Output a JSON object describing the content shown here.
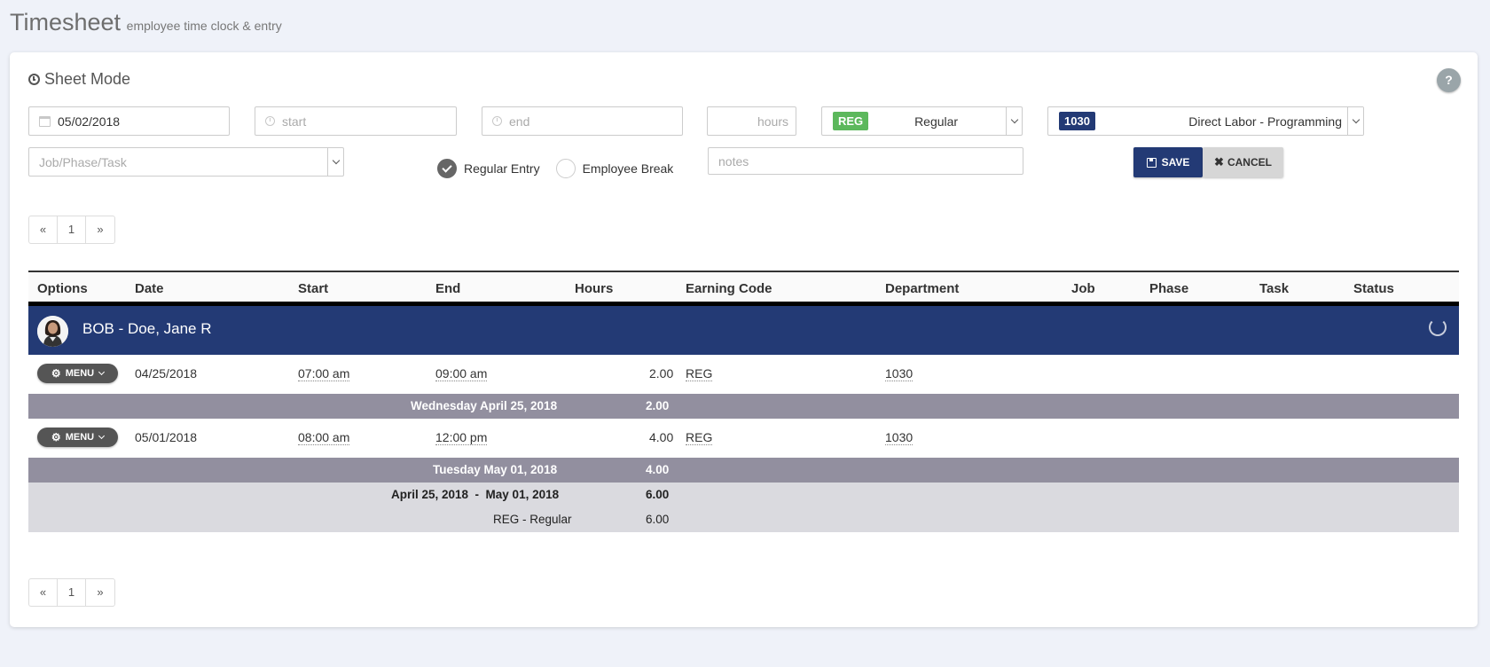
{
  "page": {
    "title": "Timesheet",
    "subtitle": "employee time clock & entry"
  },
  "panel": {
    "heading": "Sheet Mode",
    "help_label": "?"
  },
  "form": {
    "date_value": "05/02/2018",
    "start_placeholder": "start",
    "end_placeholder": "end",
    "hours_placeholder": "hours",
    "earning_code": {
      "badge": "REG",
      "label": "Regular"
    },
    "department": {
      "badge": "1030",
      "label": "Direct Labor - Programming"
    },
    "job_placeholder": "Job/Phase/Task",
    "entry_types": [
      {
        "label": "Regular Entry",
        "checked": true
      },
      {
        "label": "Employee Break",
        "checked": false
      }
    ],
    "notes_placeholder": "notes",
    "save_label": "SAVE",
    "cancel_label": "CANCEL"
  },
  "pager": {
    "prev": "«",
    "page": "1",
    "next": "»"
  },
  "columns": [
    "Options",
    "Date",
    "Start",
    "End",
    "Hours",
    "Earning Code",
    "Department",
    "Job",
    "Phase",
    "Task",
    "Status"
  ],
  "employee": {
    "name": "BOB - Doe, Jane R"
  },
  "entries": [
    {
      "menu": "MENU",
      "date": "04/25/2018",
      "start": "07:00 am",
      "end": "09:00 am",
      "hours": "2.00",
      "earning": "REG",
      "department": "1030"
    },
    {
      "menu": "MENU",
      "date": "05/01/2018",
      "start": "08:00 am",
      "end": "12:00 pm",
      "hours": "4.00",
      "earning": "REG",
      "department": "1030"
    }
  ],
  "day_totals": [
    {
      "label": "Wednesday April 25, 2018",
      "hours": "2.00"
    },
    {
      "label": "Tuesday May 01, 2018",
      "hours": "4.00"
    }
  ],
  "summary": {
    "range": "April 25, 2018  -  May 01, 2018",
    "range_hours": "6.00",
    "code_label": "REG - Regular",
    "code_hours": "6.00"
  },
  "colors": {
    "navy": "#233a75",
    "green": "#5cb85c",
    "day_total": "#928f9f",
    "summary": "#dadadf"
  }
}
